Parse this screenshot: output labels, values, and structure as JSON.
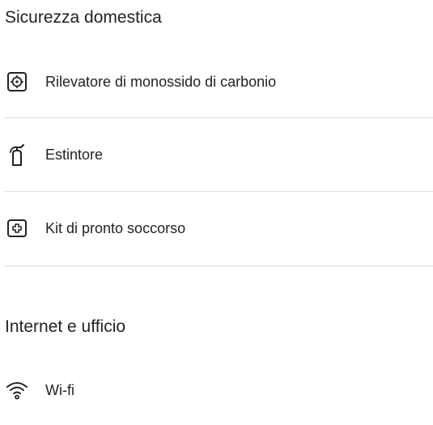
{
  "sections": [
    {
      "title": "Sicurezza domestica",
      "items": [
        {
          "label": "Rilevatore di monossido di carbonio",
          "icon": "carbon-monoxide-detector-icon"
        },
        {
          "label": "Estintore",
          "icon": "fire-extinguisher-icon"
        },
        {
          "label": "Kit di pronto soccorso",
          "icon": "first-aid-kit-icon"
        }
      ]
    },
    {
      "title": "Internet e ufficio",
      "items": [
        {
          "label": "Wi-fi",
          "icon": "wifi-icon"
        }
      ]
    }
  ]
}
